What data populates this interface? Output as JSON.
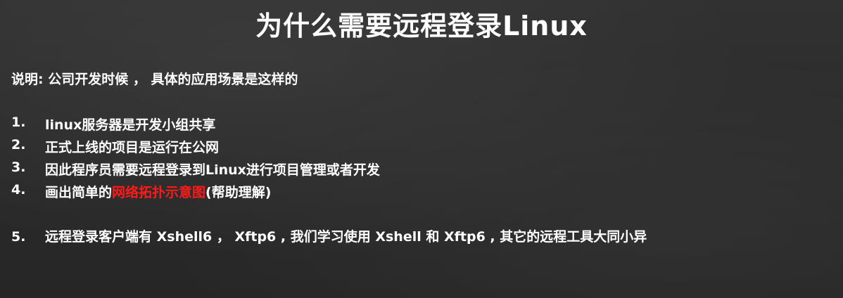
{
  "slide": {
    "title": "为什么需要远程登录Linux",
    "intro": "说明: 公司开发时候 ，  具体的应用场景是这样的",
    "items": [
      {
        "num": "1.",
        "text": "linux服务器是开发小组共享"
      },
      {
        "num": "2.",
        "text": "正式上线的项目是运行在公网"
      },
      {
        "num": "3.",
        "text": "因此程序员需要远程登录到Linux进行项目管理或者开发"
      },
      {
        "num": "4.",
        "text_before": "画出简单的",
        "highlight": "网络拓扑示意图",
        "text_after": "(帮助理解)"
      },
      {
        "num": "5.",
        "text": "远程登录客户端有 Xshell6 ， Xftp6 , 我们学习使用 Xshell 和 Xftp6 , 其它的远程工具大同小异"
      }
    ],
    "colors": {
      "background": "#2b2b2b",
      "text": "#ffffff",
      "highlight": "#ff1a1a"
    }
  }
}
